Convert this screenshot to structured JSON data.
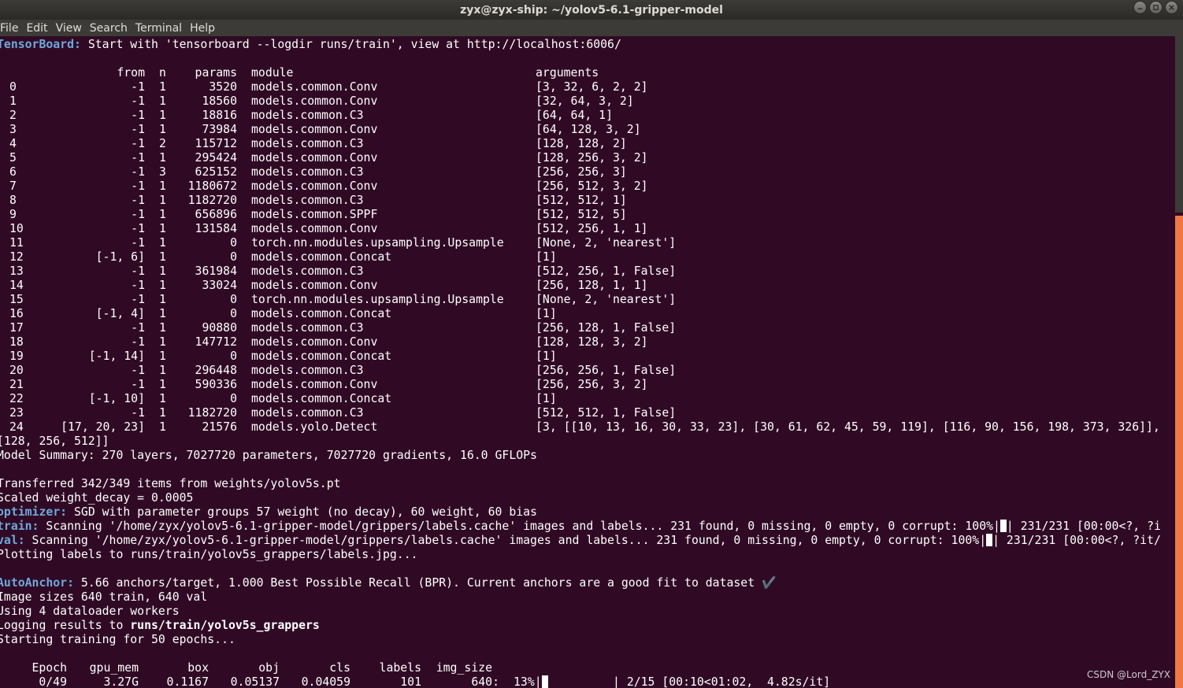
{
  "window": {
    "title": "zyx@zyx-ship: ~/yolov5-6.1-gripper-model"
  },
  "menu": [
    "File",
    "Edit",
    "View",
    "Search",
    "Terminal",
    "Help"
  ],
  "colors": {
    "background": "#300a24",
    "prefix": "#6fa8dc",
    "text": "#ffffff",
    "scrollbar": "#ef7943"
  },
  "terminal": {
    "tensorboard_prefix": "TensorBoard:",
    "tensorboard_text": " Start with 'tensorboard --logdir runs/train', view at http://localhost:6006/",
    "table_header": {
      "from": "from",
      "n": "n",
      "params": "params",
      "module": "module",
      "arguments": "arguments"
    },
    "layers": [
      {
        "idx": "0",
        "from": "-1",
        "n": "1",
        "params": "3520",
        "module": "models.common.Conv",
        "arguments": "[3, 32, 6, 2, 2]"
      },
      {
        "idx": "1",
        "from": "-1",
        "n": "1",
        "params": "18560",
        "module": "models.common.Conv",
        "arguments": "[32, 64, 3, 2]"
      },
      {
        "idx": "2",
        "from": "-1",
        "n": "1",
        "params": "18816",
        "module": "models.common.C3",
        "arguments": "[64, 64, 1]"
      },
      {
        "idx": "3",
        "from": "-1",
        "n": "1",
        "params": "73984",
        "module": "models.common.Conv",
        "arguments": "[64, 128, 3, 2]"
      },
      {
        "idx": "4",
        "from": "-1",
        "n": "2",
        "params": "115712",
        "module": "models.common.C3",
        "arguments": "[128, 128, 2]"
      },
      {
        "idx": "5",
        "from": "-1",
        "n": "1",
        "params": "295424",
        "module": "models.common.Conv",
        "arguments": "[128, 256, 3, 2]"
      },
      {
        "idx": "6",
        "from": "-1",
        "n": "3",
        "params": "625152",
        "module": "models.common.C3",
        "arguments": "[256, 256, 3]"
      },
      {
        "idx": "7",
        "from": "-1",
        "n": "1",
        "params": "1180672",
        "module": "models.common.Conv",
        "arguments": "[256, 512, 3, 2]"
      },
      {
        "idx": "8",
        "from": "-1",
        "n": "1",
        "params": "1182720",
        "module": "models.common.C3",
        "arguments": "[512, 512, 1]"
      },
      {
        "idx": "9",
        "from": "-1",
        "n": "1",
        "params": "656896",
        "module": "models.common.SPPF",
        "arguments": "[512, 512, 5]"
      },
      {
        "idx": "10",
        "from": "-1",
        "n": "1",
        "params": "131584",
        "module": "models.common.Conv",
        "arguments": "[512, 256, 1, 1]"
      },
      {
        "idx": "11",
        "from": "-1",
        "n": "1",
        "params": "0",
        "module": "torch.nn.modules.upsampling.Upsample",
        "arguments": "[None, 2, 'nearest']"
      },
      {
        "idx": "12",
        "from": "[-1, 6]",
        "n": "1",
        "params": "0",
        "module": "models.common.Concat",
        "arguments": "[1]"
      },
      {
        "idx": "13",
        "from": "-1",
        "n": "1",
        "params": "361984",
        "module": "models.common.C3",
        "arguments": "[512, 256, 1, False]"
      },
      {
        "idx": "14",
        "from": "-1",
        "n": "1",
        "params": "33024",
        "module": "models.common.Conv",
        "arguments": "[256, 128, 1, 1]"
      },
      {
        "idx": "15",
        "from": "-1",
        "n": "1",
        "params": "0",
        "module": "torch.nn.modules.upsampling.Upsample",
        "arguments": "[None, 2, 'nearest']"
      },
      {
        "idx": "16",
        "from": "[-1, 4]",
        "n": "1",
        "params": "0",
        "module": "models.common.Concat",
        "arguments": "[1]"
      },
      {
        "idx": "17",
        "from": "-1",
        "n": "1",
        "params": "90880",
        "module": "models.common.C3",
        "arguments": "[256, 128, 1, False]"
      },
      {
        "idx": "18",
        "from": "-1",
        "n": "1",
        "params": "147712",
        "module": "models.common.Conv",
        "arguments": "[128, 128, 3, 2]"
      },
      {
        "idx": "19",
        "from": "[-1, 14]",
        "n": "1",
        "params": "0",
        "module": "models.common.Concat",
        "arguments": "[1]"
      },
      {
        "idx": "20",
        "from": "-1",
        "n": "1",
        "params": "296448",
        "module": "models.common.C3",
        "arguments": "[256, 256, 1, False]"
      },
      {
        "idx": "21",
        "from": "-1",
        "n": "1",
        "params": "590336",
        "module": "models.common.Conv",
        "arguments": "[256, 256, 3, 2]"
      },
      {
        "idx": "22",
        "from": "[-1, 10]",
        "n": "1",
        "params": "0",
        "module": "models.common.Concat",
        "arguments": "[1]"
      },
      {
        "idx": "23",
        "from": "-1",
        "n": "1",
        "params": "1182720",
        "module": "models.common.C3",
        "arguments": "[512, 512, 1, False]"
      },
      {
        "idx": "24",
        "from": "[17, 20, 23]",
        "n": "1",
        "params": "21576",
        "module": "models.yolo.Detect",
        "arguments": "[3, [[10, 13, 16, 30, 33, 23], [30, 61, 62, 45, 59, 119], [116, 90, 156, 198, 373, 326]],"
      }
    ],
    "detect_args_cont": "[128, 256, 512]]",
    "model_summary": "Model Summary: 270 layers, 7027720 parameters, 7027720 gradients, 16.0 GFLOPs",
    "transferred": "Transferred 342/349 items from weights/yolov5s.pt",
    "scaled": "Scaled weight_decay = 0.0005",
    "optimizer_prefix": "optimizer:",
    "optimizer_text": " SGD with parameter groups 57 weight (no decay), 60 weight, 60 bias",
    "train_prefix": "train:",
    "train_text_a": " Scanning '/home/zyx/yolov5-6.1-gripper-model/grippers/labels.cache' images and labels... 231 found, 0 missing, 0 empty, 0 corrupt: 100%|",
    "train_text_b": "| 231/231 [00:00<?, ?i",
    "val_prefix": "val:",
    "val_text_a": " Scanning '/home/zyx/yolov5-6.1-gripper-model/grippers/labels.cache' images and labels... 231 found, 0 missing, 0 empty, 0 corrupt: 100%|",
    "val_text_b": "| 231/231 [00:00<?, ?it/",
    "plotting": "Plotting labels to runs/train/yolov5s_grappers/labels.jpg...",
    "autoanchor_prefix": "AutoAnchor:",
    "autoanchor_text": " 5.66 anchors/target, 1.000 Best Possible Recall (BPR). Current anchors are a good fit to dataset ✔️",
    "image_sizes": "Image sizes 640 train, 640 val",
    "using_workers": "Using 4 dataloader workers",
    "logging_prefix": "Logging results to ",
    "logging_path": "runs/train/yolov5s_grappers",
    "starting": "Starting training for 50 epochs...",
    "train_header": {
      "epoch": "Epoch",
      "gpu_mem": "gpu_mem",
      "box": "box",
      "obj": "obj",
      "cls": "cls",
      "labels": "labels",
      "img_size": "img_size"
    },
    "train_row": {
      "epoch": "0/49",
      "gpu_mem": "3.27G",
      "box": "0.1167",
      "obj": "0.05137",
      "cls": "0.04059",
      "labels": "101",
      "img_size": "640:",
      "pct": "13%|",
      "progress": "| 2/15 [00:10<01:02,  4.82s/it]"
    }
  },
  "watermark": "CSDN @Lord_ZYX"
}
